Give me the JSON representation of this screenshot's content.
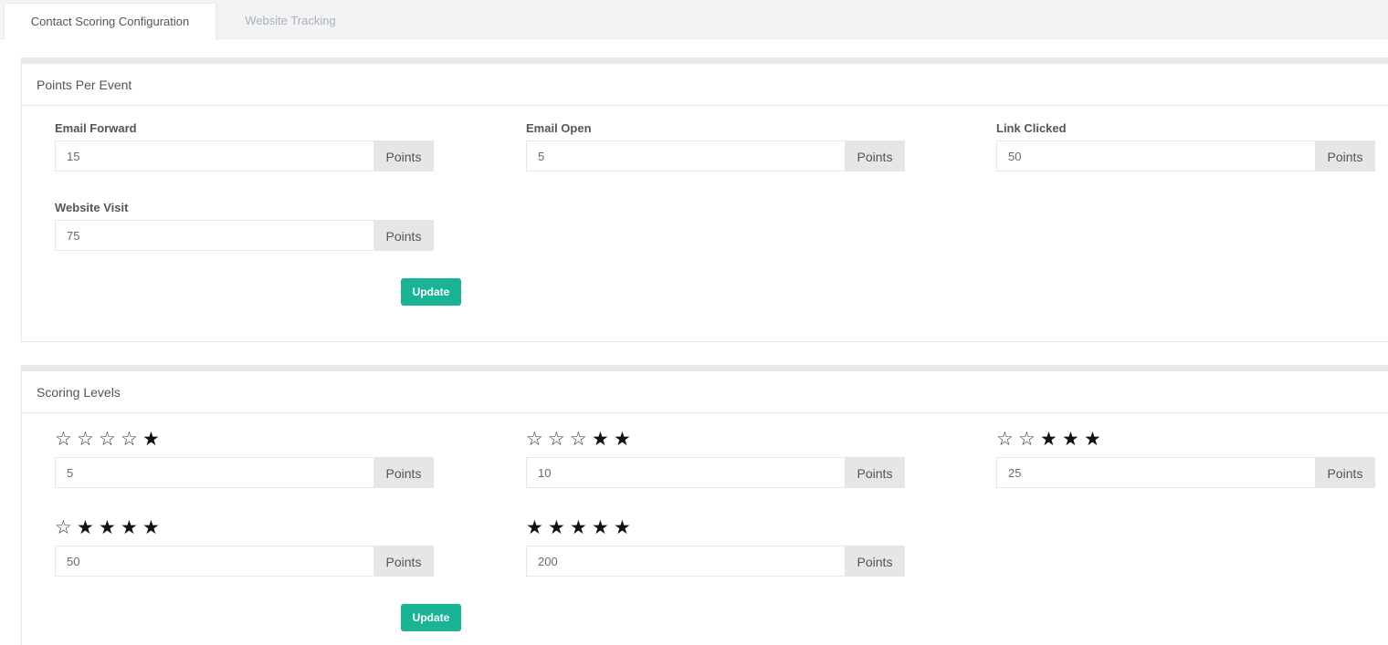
{
  "tabs": [
    {
      "label": "Contact Scoring Configuration",
      "active": true
    },
    {
      "label": "Website Tracking",
      "active": false
    }
  ],
  "points_per_event": {
    "title": "Points Per Event",
    "fields": [
      {
        "label": "Email Forward",
        "value": "15",
        "unit": "Points"
      },
      {
        "label": "Email Open",
        "value": "5",
        "unit": "Points"
      },
      {
        "label": "Link Clicked",
        "value": "50",
        "unit": "Points"
      },
      {
        "label": "Website Visit",
        "value": "75",
        "unit": "Points"
      }
    ],
    "button_label": "Update"
  },
  "scoring_levels": {
    "title": "Scoring Levels",
    "levels": [
      {
        "filled_stars": 1,
        "total_stars": 5,
        "value": "5",
        "unit": "Points"
      },
      {
        "filled_stars": 2,
        "total_stars": 5,
        "value": "10",
        "unit": "Points"
      },
      {
        "filled_stars": 3,
        "total_stars": 5,
        "value": "25",
        "unit": "Points"
      },
      {
        "filled_stars": 4,
        "total_stars": 5,
        "value": "50",
        "unit": "Points"
      },
      {
        "filled_stars": 5,
        "total_stars": 5,
        "value": "200",
        "unit": "Points"
      }
    ],
    "button_label": "Update"
  },
  "colors": {
    "accent": "#1ab394",
    "tab_inactive_text": "#a7b1c2",
    "border": "#e7eaec",
    "addon_bg": "#e5e6e7"
  },
  "icons": {
    "filled_star": "star-filled-icon",
    "empty_star": "star-outline-icon"
  }
}
